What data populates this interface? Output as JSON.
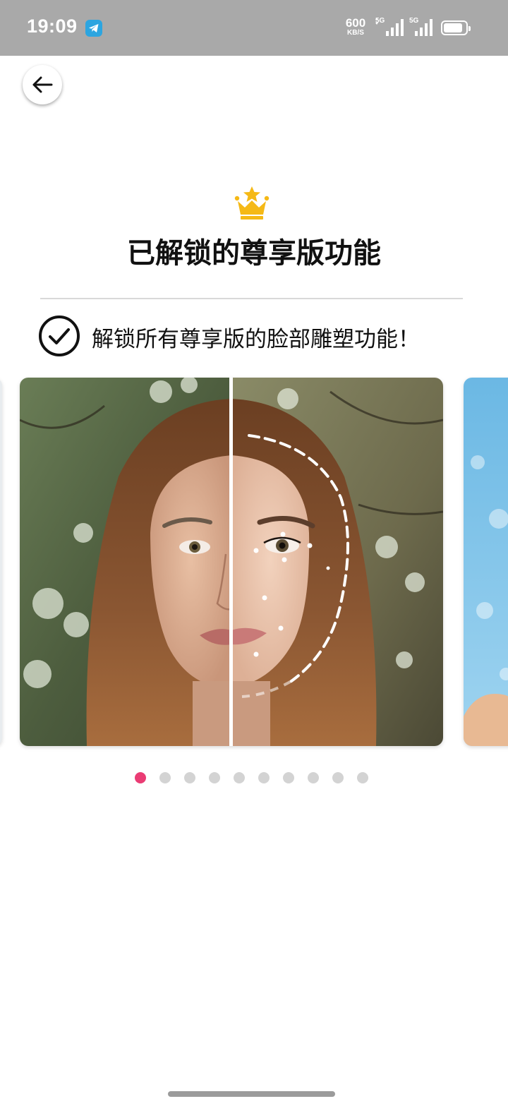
{
  "status_bar": {
    "time": "19:09",
    "net_speed_value": "600",
    "net_speed_unit": "KB/S",
    "signal_1_label": "5G",
    "signal_2_label": "5G",
    "battery_level": 0.8,
    "background": "#a9a9a9"
  },
  "header": {
    "back_icon": "arrow-left-icon"
  },
  "premium": {
    "crown_icon": "crown-icon",
    "title": "已解锁的尊享版功能",
    "feature_icon": "check-circle-icon",
    "feature_text": "解锁所有尊享版的脸部雕塑功能！"
  },
  "carousel": {
    "slides_total": 10,
    "active_index": 0,
    "active_color": "#ea3c74",
    "inactive_color": "#d3d3d3"
  }
}
